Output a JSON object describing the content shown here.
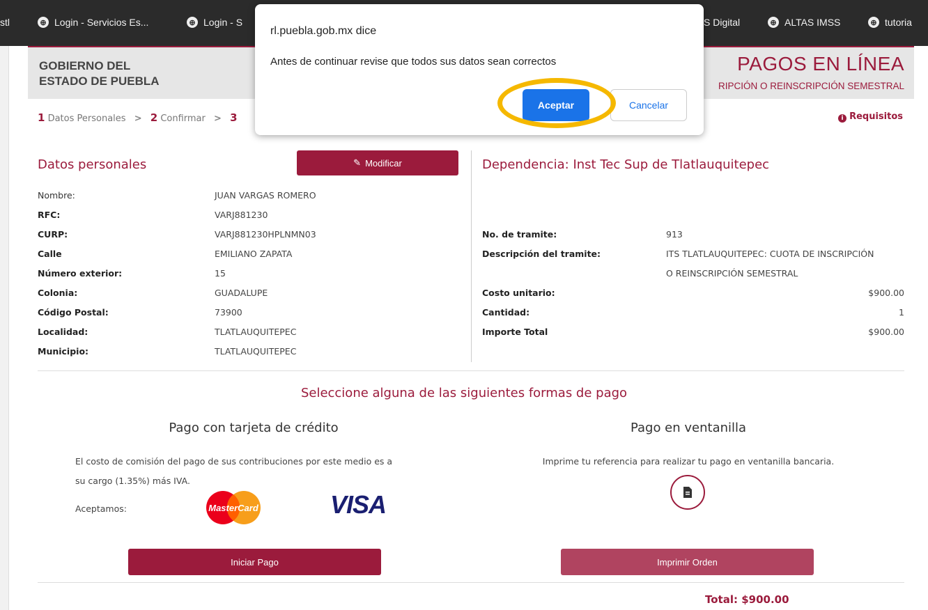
{
  "bookmarks": [
    {
      "label": "stl"
    },
    {
      "label": "Login - Servicios Es..."
    },
    {
      "label": "Login - S"
    },
    {
      "label": "S Digital"
    },
    {
      "label": "ALTAS IMSS"
    },
    {
      "label": "tutoria"
    }
  ],
  "header": {
    "org_line1": "GOBIERNO DEL",
    "org_line2": "ESTADO DE PUEBLA",
    "title": "PAGOS EN LÍNEA",
    "subtitle": "RIPCIÓN O REINSCRIPCIÓN SEMESTRAL"
  },
  "steps": {
    "s1_num": "1",
    "s1_label": "Datos Personales",
    "s2_num": "2",
    "s2_label": "Confirmar",
    "s3_num": "3",
    "sep": ">",
    "requisitos": "Requisitos"
  },
  "personal": {
    "title": "Datos personales",
    "modify_label": "Modificar",
    "fields": [
      {
        "label": "Nombre:",
        "value": "JUAN VARGAS ROMERO"
      },
      {
        "label": "RFC:",
        "value": "VARJ881230"
      },
      {
        "label": "CURP:",
        "value": "VARJ881230HPLNMN03"
      },
      {
        "label": "Calle",
        "value": "EMILIANO ZAPATA"
      },
      {
        "label": "Número exterior:",
        "value": "15"
      },
      {
        "label": "Colonia:",
        "value": "GUADALUPE"
      },
      {
        "label": "Código Postal:",
        "value": "73900"
      },
      {
        "label": "Localidad:",
        "value": "TLATLAUQUITEPEC"
      },
      {
        "label": "Municipio:",
        "value": "TLATLAUQUITEPEC"
      }
    ]
  },
  "dependency": {
    "title": "Dependencia: Inst Tec Sup de Tlatlauquitepec",
    "tramite_label": "No. de tramite:",
    "tramite_value": "913",
    "desc_label": "Descripción del tramite:",
    "desc_line1": "ITS TLATLAUQUITEPEC: CUOTA DE INSCRIPCIÓN",
    "desc_line2": "O REINSCRIPCIÓN SEMESTRAL",
    "costo_label": "Costo unitario:",
    "costo_value": "$900.00",
    "cantidad_label": "Cantidad:",
    "cantidad_value": "1",
    "importe_label": "Importe Total",
    "importe_value": "$900.00"
  },
  "payment": {
    "heading": "Seleccione alguna de las siguientes formas de pago",
    "card_title": "Pago con tarjeta de crédito",
    "card_note_1": "El costo de comisión del pago de sus contribuciones por este medio es a",
    "card_note_2": "su cargo (1.35%) más IVA.",
    "accept_label": "Aceptamos:",
    "mastercard_text": "MasterCard",
    "visa_text": "VISA",
    "start_button": "Iniciar Pago",
    "window_title": "Pago en ventanilla",
    "window_note": "Imprime tu referencia para realizar tu pago en ventanilla bancaria.",
    "print_button": "Imprimir Orden",
    "total": "Total: $900.00"
  },
  "dialog": {
    "title": "rl.puebla.gob.mx dice",
    "message": "Antes de continuar revise que todos sus datos sean correctos",
    "ok_label": "Aceptar",
    "cancel_label": "Cancelar"
  },
  "colors": {
    "brand": "#9b1b3c",
    "dialog_primary": "#1a73e8",
    "highlight": "#f5b800"
  }
}
